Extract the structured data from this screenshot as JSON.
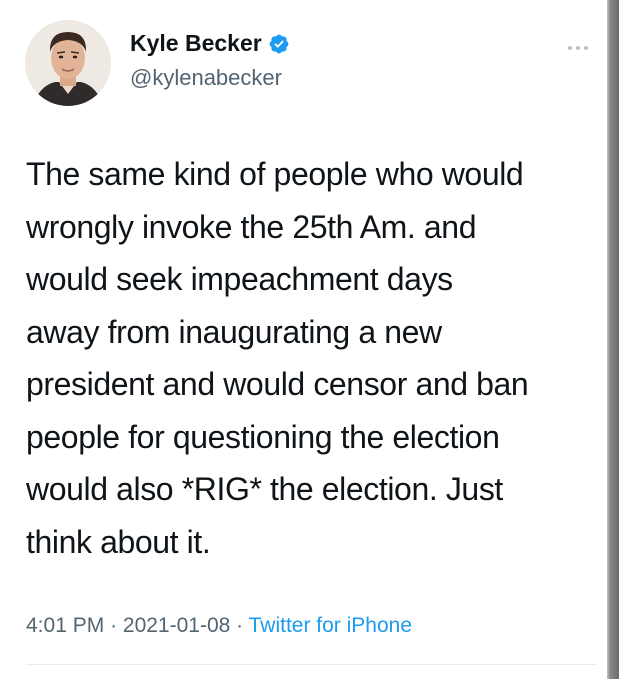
{
  "author": {
    "display_name": "Kyle Becker",
    "handle": "@kylenabecker",
    "verified": true
  },
  "tweet": {
    "lines": [
      "The same kind of people who would",
      "wrongly invoke the 25th Am. and",
      "would seek impeachment days",
      "away from inaugurating a new",
      "president and would censor and ban",
      "people for questioning the election",
      "would also *RIG* the election. Just",
      "think about it."
    ]
  },
  "meta": {
    "time": "4:01 PM",
    "separator": "·",
    "date": "2021-01-08",
    "source": "Twitter for iPhone"
  },
  "icons": {
    "verified": "verified-badge-icon",
    "more": "more-options-icon"
  },
  "colors": {
    "accent": "#1d9bf0",
    "text": "#0f1419",
    "secondary": "#536471"
  }
}
